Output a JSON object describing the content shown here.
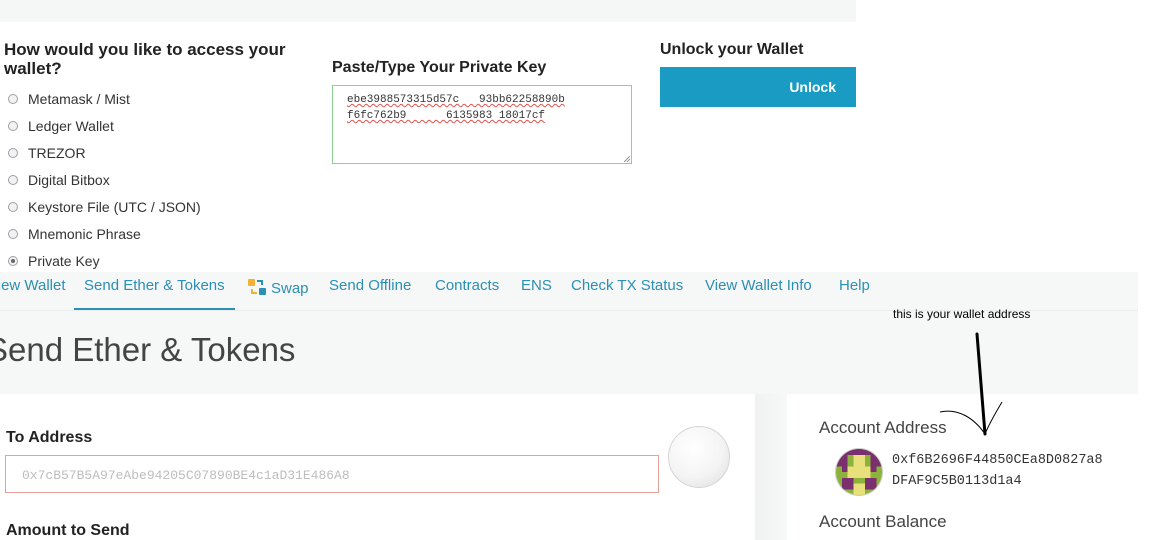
{
  "access": {
    "question": "How would you like to access your wallet?",
    "options": [
      {
        "label": "Metamask / Mist",
        "selected": false
      },
      {
        "label": "Ledger Wallet",
        "selected": false
      },
      {
        "label": "TREZOR",
        "selected": false
      },
      {
        "label": "Digital Bitbox",
        "selected": false
      },
      {
        "label": "Keystore File (UTC / JSON)",
        "selected": false
      },
      {
        "label": "Mnemonic Phrase",
        "selected": false
      },
      {
        "label": "Private Key",
        "selected": true
      }
    ]
  },
  "private_key": {
    "label": "Paste/Type Your Private Key",
    "line1": "ebe3988573315d57c   93bb62258890b",
    "line2": "f6fc762b9      6135983 18017cf"
  },
  "unlock": {
    "label": "Unlock your Wallet",
    "button": "Unlock"
  },
  "nav": {
    "items": [
      "View Wallet",
      "Send Ether & Tokens",
      "Swap",
      "Send Offline",
      "Contracts",
      "ENS",
      "Check TX Status",
      "View Wallet Info",
      "Help"
    ],
    "active": "Send Ether & Tokens"
  },
  "page": {
    "title": "Send Ether & Tokens"
  },
  "send_form": {
    "to_label": "To Address",
    "to_placeholder": "0x7cB57B5A97eAbe94205C07890BE4c1aD31E486A8",
    "amount_label": "Amount to Send"
  },
  "account": {
    "address_label": "Account Address",
    "address_line1": "0xf6B2696F44850CEa8D0827a8",
    "address_line2": "DFAF9C5B0113d1a4",
    "balance_label": "Account Balance"
  },
  "annotation": {
    "text": "this is your wallet address"
  },
  "colors": {
    "accent": "#1a9bc4",
    "nav_link": "#2c8fb4",
    "input_error_border": "#e9a09a",
    "input_ok_border": "#8ed08e"
  }
}
